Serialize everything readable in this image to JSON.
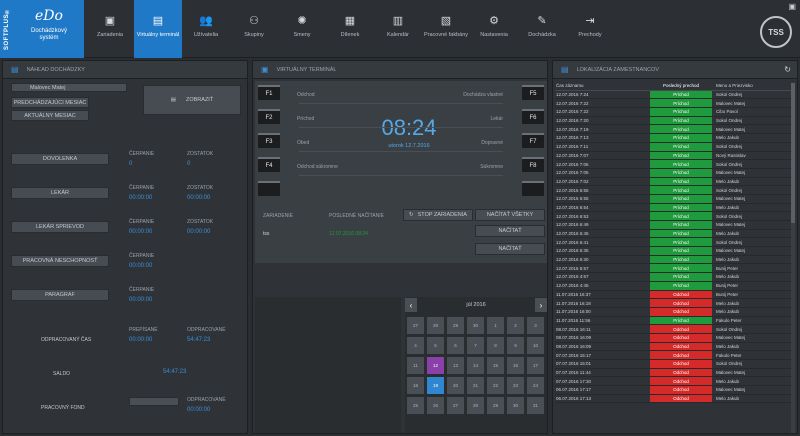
{
  "brand": {
    "strip": "SOFTPLUS®",
    "logo": "eDo",
    "subtitle1": "Dochádzkový",
    "subtitle2": "systém"
  },
  "nav": [
    {
      "icon": "▣",
      "label": "Zariadenia"
    },
    {
      "icon": "▤",
      "label": "Virtuálny terminál"
    },
    {
      "icon": "👥",
      "label": "Užívatelia"
    },
    {
      "icon": "⚇",
      "label": "Skupiny"
    },
    {
      "icon": "✺",
      "label": "Smeny"
    },
    {
      "icon": "▦",
      "label": "Dílenek"
    },
    {
      "icon": "▥",
      "label": "Kalendár"
    },
    {
      "icon": "▧",
      "label": "Pracovné fakbány"
    },
    {
      "icon": "⚙",
      "label": "Nastavenia"
    },
    {
      "icon": "✎",
      "label": "Dochádzka"
    },
    {
      "icon": "⇥",
      "label": "Prechody"
    }
  ],
  "corner_logo": "TSS",
  "left": {
    "title": "NÁHĽAD DOCHÁDZKY",
    "employee": "Malovec Matej",
    "btn_prev": "PREDCHÁDZAJÚCI MESIAC",
    "btn_current": "AKTUÁLNY MESIAC",
    "btn_show": "ZOBRAZIŤ",
    "rows": [
      {
        "label": "DOVOLENKA",
        "h1": "ČERPANIE",
        "v1": "0",
        "h2": "ZOSTATOK",
        "v2": "0"
      },
      {
        "label": "LEKÁR",
        "h1": "ČERPANIE",
        "v1": "00:00:00",
        "h2": "ZOSTATOK",
        "v2": "00:00:00"
      },
      {
        "label": "LEKÁR SPRIEVOD",
        "h1": "ČERPANIE",
        "v1": "00:00:00",
        "h2": "ZOSTATOK",
        "v2": "00:00:00"
      },
      {
        "label": "PRACOVNÁ NESCHOPNOSŤ",
        "h1": "ČERPANIE",
        "v1": "00:00:00",
        "h2": "",
        "v2": ""
      },
      {
        "label": "PARAGRAF",
        "h1": "ČERPANIE",
        "v1": "00:00:00",
        "h2": "",
        "v2": ""
      }
    ],
    "worked": {
      "label": "ODPRACOVANÝ ČAS",
      "h1": "PREPÍSANÉ",
      "v1": "00:00:00",
      "h2": "ODPRACOVANÉ",
      "v2": "54:47:23"
    },
    "saldo": {
      "label": "SALDO",
      "value": "54:47:23"
    },
    "fund": {
      "label": "PRACOVNÝ FOND",
      "h2": "ODPRACOVANÉ",
      "v2": "00:00:00"
    }
  },
  "mid": {
    "title": "VIRTUÁLNY TERMINÁL",
    "fkeys_left": [
      "F1",
      "F2",
      "F3",
      "F4",
      ""
    ],
    "fkeys_right": [
      "F5",
      "F6",
      "F7",
      "F8",
      ""
    ],
    "labels_left": [
      "Odchod",
      "Príchod",
      "Obed",
      "Odchod súkromne"
    ],
    "labels_right": [
      "Dochádza vlastné",
      "Lekár",
      "Dopravné",
      "Súkromne"
    ],
    "clock": "08:24",
    "date": "utorok 12.7.2016",
    "h_device": "ZARIADENIE",
    "h_last": "POSLEDNÉ NAČÍTANIE",
    "btn_stop": "STOP ZARIADENIA",
    "btn_all": "NAČÍTAŤ VŠETKY",
    "btn_load1": "NAČÍTAŤ",
    "btn_load2": "NAČÍTAŤ",
    "device_name": "tss",
    "device_last": "12.07.2016 08:24",
    "cal_title": "júl 2016",
    "cal_prev": "‹",
    "cal_next": "›",
    "cal_days": [
      "27",
      "28",
      "29",
      "30",
      "1",
      "2",
      "3",
      "4",
      "5",
      "6",
      "7",
      "8",
      "9",
      "10",
      "11",
      "12",
      "13",
      "14",
      "15",
      "16",
      "17",
      "18",
      "19",
      "20",
      "21",
      "22",
      "23",
      "24",
      "25",
      "26",
      "27",
      "28",
      "29",
      "30",
      "31"
    ]
  },
  "right": {
    "title": "LOKALIZÁCIA ZAMESTNANCOV",
    "refresh": "↻",
    "headers": [
      "Čas záznamu",
      "Posledný prechod",
      "Meno a Priezvisko"
    ],
    "rows": [
      [
        "12.07.2016 7:24",
        "Príchod",
        "Sokol Ondrej"
      ],
      [
        "12.07.2016 7:22",
        "Príchod",
        "Malovec Matej"
      ],
      [
        "12.07.2016 7:22",
        "Príchod",
        "Cibo Pavol"
      ],
      [
        "12.07.2016 7:20",
        "Príchod",
        "Sokol Ondrej"
      ],
      [
        "12.07.2016 7:19",
        "Príchod",
        "Malovec Matej"
      ],
      [
        "12.07.2016 7:13",
        "Príchod",
        "Melo Jakub"
      ],
      [
        "12.07.2016 7:11",
        "Príchod",
        "Sokol Ondrej"
      ],
      [
        "12.07.2016 7:07",
        "Príchod",
        "Nový Rastislav"
      ],
      [
        "12.07.2016 7:06",
        "Príchod",
        "Sokol Ondrej"
      ],
      [
        "12.07.2016 7:05",
        "Príchod",
        "Malovec Matej"
      ],
      [
        "12.07.2016 7:02",
        "Príchod",
        "Melo Jakub"
      ],
      [
        "12.07.2016 6:55",
        "Príchod",
        "Sokol Ondrej"
      ],
      [
        "12.07.2016 6:55",
        "Príchod",
        "Malovec Matej"
      ],
      [
        "12.07.2016 6:54",
        "Príchod",
        "Melo Jakub"
      ],
      [
        "12.07.2016 6:53",
        "Príchod",
        "Sokol Ondrej"
      ],
      [
        "12.07.2016 6:49",
        "Príchod",
        "Malovec Matej"
      ],
      [
        "12.07.2016 6:45",
        "Príchod",
        "Melo Jakub"
      ],
      [
        "12.07.2016 6:41",
        "Príchod",
        "Sokol Ondrej"
      ],
      [
        "12.07.2016 6:35",
        "Príchod",
        "Malovec Matej"
      ],
      [
        "12.07.2016 6:30",
        "Príchod",
        "Melo Jakub"
      ],
      [
        "12.07.2016 5:57",
        "Príchod",
        "Bunij Peter"
      ],
      [
        "12.07.2016 4:57",
        "Príchod",
        "Melo Jakub"
      ],
      [
        "12.07.2016 4:45",
        "Príchod",
        "Bunij Peter"
      ],
      [
        "11.07.2016 16:37",
        "Odchod",
        "Bunij Peter"
      ],
      [
        "11.07.2016 16:18",
        "Odchod",
        "Melo Jakub"
      ],
      [
        "11.07.2016 16:00",
        "Odchod",
        "Melo Jakub"
      ],
      [
        "11.07.2016 11:56",
        "Príchod",
        "Fakulo Peter"
      ],
      [
        "08.07.2016 16:11",
        "Odchod",
        "Sokol Ondrej"
      ],
      [
        "08.07.2016 16:09",
        "Odchod",
        "Malovec Matej"
      ],
      [
        "08.07.2016 16:09",
        "Odchod",
        "Melo Jakub"
      ],
      [
        "07.07.2016 15:17",
        "Odchod",
        "Fakulo Peter"
      ],
      [
        "07.07.2016 15:01",
        "Odchod",
        "Sokol Ondrej"
      ],
      [
        "07.07.2016 11:44",
        "Odchod",
        "Malovec Matej"
      ],
      [
        "07.07.2016 17:30",
        "Odchod",
        "Melo Jakub"
      ],
      [
        "06.07.2016 17:17",
        "Odchod",
        "Malovec Matej"
      ],
      [
        "06.07.2016 17:13",
        "Odchod",
        "Melo Jakub"
      ]
    ],
    "colors": {
      "in": "#1f9a3c",
      "out": "#d42a2a"
    }
  },
  "colors": {
    "accent": "#1f79c6"
  }
}
